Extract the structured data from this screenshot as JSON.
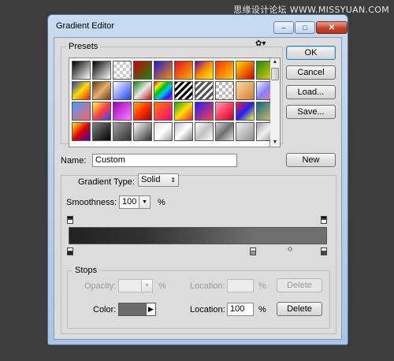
{
  "watermark": "思缘设计论坛 WWW.MISSYUAN.COM",
  "window": {
    "title": "Gradient Editor",
    "minimize": "–",
    "maximize": "□",
    "close": "✕"
  },
  "buttons": {
    "ok": "OK",
    "cancel": "Cancel",
    "load": "Load...",
    "save": "Save...",
    "new": "New"
  },
  "presets": {
    "legend": "Presets",
    "menu_icon": "gear-icon",
    "menu_glyph": "✿▾",
    "swatches": [
      "linear-gradient(135deg,#000,#fff)",
      "linear-gradient(135deg,#000,#fff)",
      "repeating-conic-gradient(#ccc 0 25%,#fff 0 50%) 0 0/8px 8px",
      "linear-gradient(135deg,#c00,#1a8a1a)",
      "linear-gradient(135deg,#1b1bdc,#ff8a00)",
      "linear-gradient(135deg,#e01020,#ffb000)",
      "linear-gradient(135deg,#6a00b8,#ff9000,#ffee00)",
      "linear-gradient(135deg,#ff3000,#ffd000)",
      "linear-gradient(135deg,#ffe000,#d80000)",
      "linear-gradient(135deg,#1a8a1a,#f3d200)",
      "linear-gradient(135deg,#1a40c0,#ffdd00,#e02010)",
      "linear-gradient(135deg,#6a3a10,#e8b070,#6a3a10)",
      "linear-gradient(135deg,#fff,#1a40ff)",
      "linear-gradient(135deg,#0a8a0a,#e8e8e8,#c01010)",
      "linear-gradient(135deg,#ff0000,#ffee00,#00c000,#00c0ff,#2020ff,#ff00ff)",
      "repeating-linear-gradient(135deg,#000 0 3px,#fff 3px 6px)",
      "repeating-linear-gradient(135deg,#555 0 3px,#fff 3px 6px)",
      "repeating-conic-gradient(#bbb 0 25%,#fff 0 50%) 0 0/8px 8px",
      "linear-gradient(135deg,#ffd9a0,#d08030)",
      "linear-gradient(135deg,#f0f0ff,#8080ff,#ff8080)",
      "linear-gradient(135deg,#40a0ff,#ff6060)",
      "linear-gradient(135deg,#ffff40,#ff4040,#4040ff)",
      "linear-gradient(135deg,#a000c0,#ff80ff)",
      "linear-gradient(135deg,#ffb000,#ff3000,#a00000)",
      "linear-gradient(135deg,#ff8000,#ff0080)",
      "linear-gradient(135deg,#20a020,#ffe000,#ff2020)",
      "linear-gradient(135deg,#2020ff,#ff4040)",
      "linear-gradient(135deg,#ffa0c0,#ff4060,#c00030)",
      "linear-gradient(135deg,#ff2020,#2020ff,#ffff20)",
      "linear-gradient(135deg,#0a6a8a,#e8c060)",
      "linear-gradient(135deg,#ffee00,#e00000,#4000c0)",
      "linear-gradient(135deg,#808080,#000)",
      "linear-gradient(135deg,#a0a0a0,#303030)",
      "linear-gradient(135deg,#ffffff,#303030)",
      "linear-gradient(135deg,#e0e0e0,#fff,#a0a0a0)",
      "linear-gradient(135deg,#c0c0c0,#fff,#808080)",
      "linear-gradient(135deg,#fff,#c0c0c0,#fff)",
      "linear-gradient(135deg,#d0d0d0,#707070,#e0e0e0)",
      "linear-gradient(135deg,#f0f0f0,#909090)",
      "linear-gradient(135deg,#a0a0a0,#f0f0f0,#909090)"
    ]
  },
  "name": {
    "label": "Name:",
    "value": "Custom"
  },
  "gradient_type": {
    "label": "Gradient Type:",
    "value": "Solid"
  },
  "smoothness": {
    "label": "Smoothness:",
    "value": "100",
    "unit": "%"
  },
  "stops": {
    "legend": "Stops",
    "opacity_label": "Opacity:",
    "opacity_value": "",
    "opacity_unit": "%",
    "opacity_location_label": "Location:",
    "opacity_location_value": "",
    "opacity_location_unit": "%",
    "opacity_delete": "Delete",
    "color_label": "Color:",
    "color_value": "#6b6b6b",
    "color_location_label": "Location:",
    "color_location_value": "100",
    "color_location_unit": "%",
    "color_delete": "Delete"
  }
}
